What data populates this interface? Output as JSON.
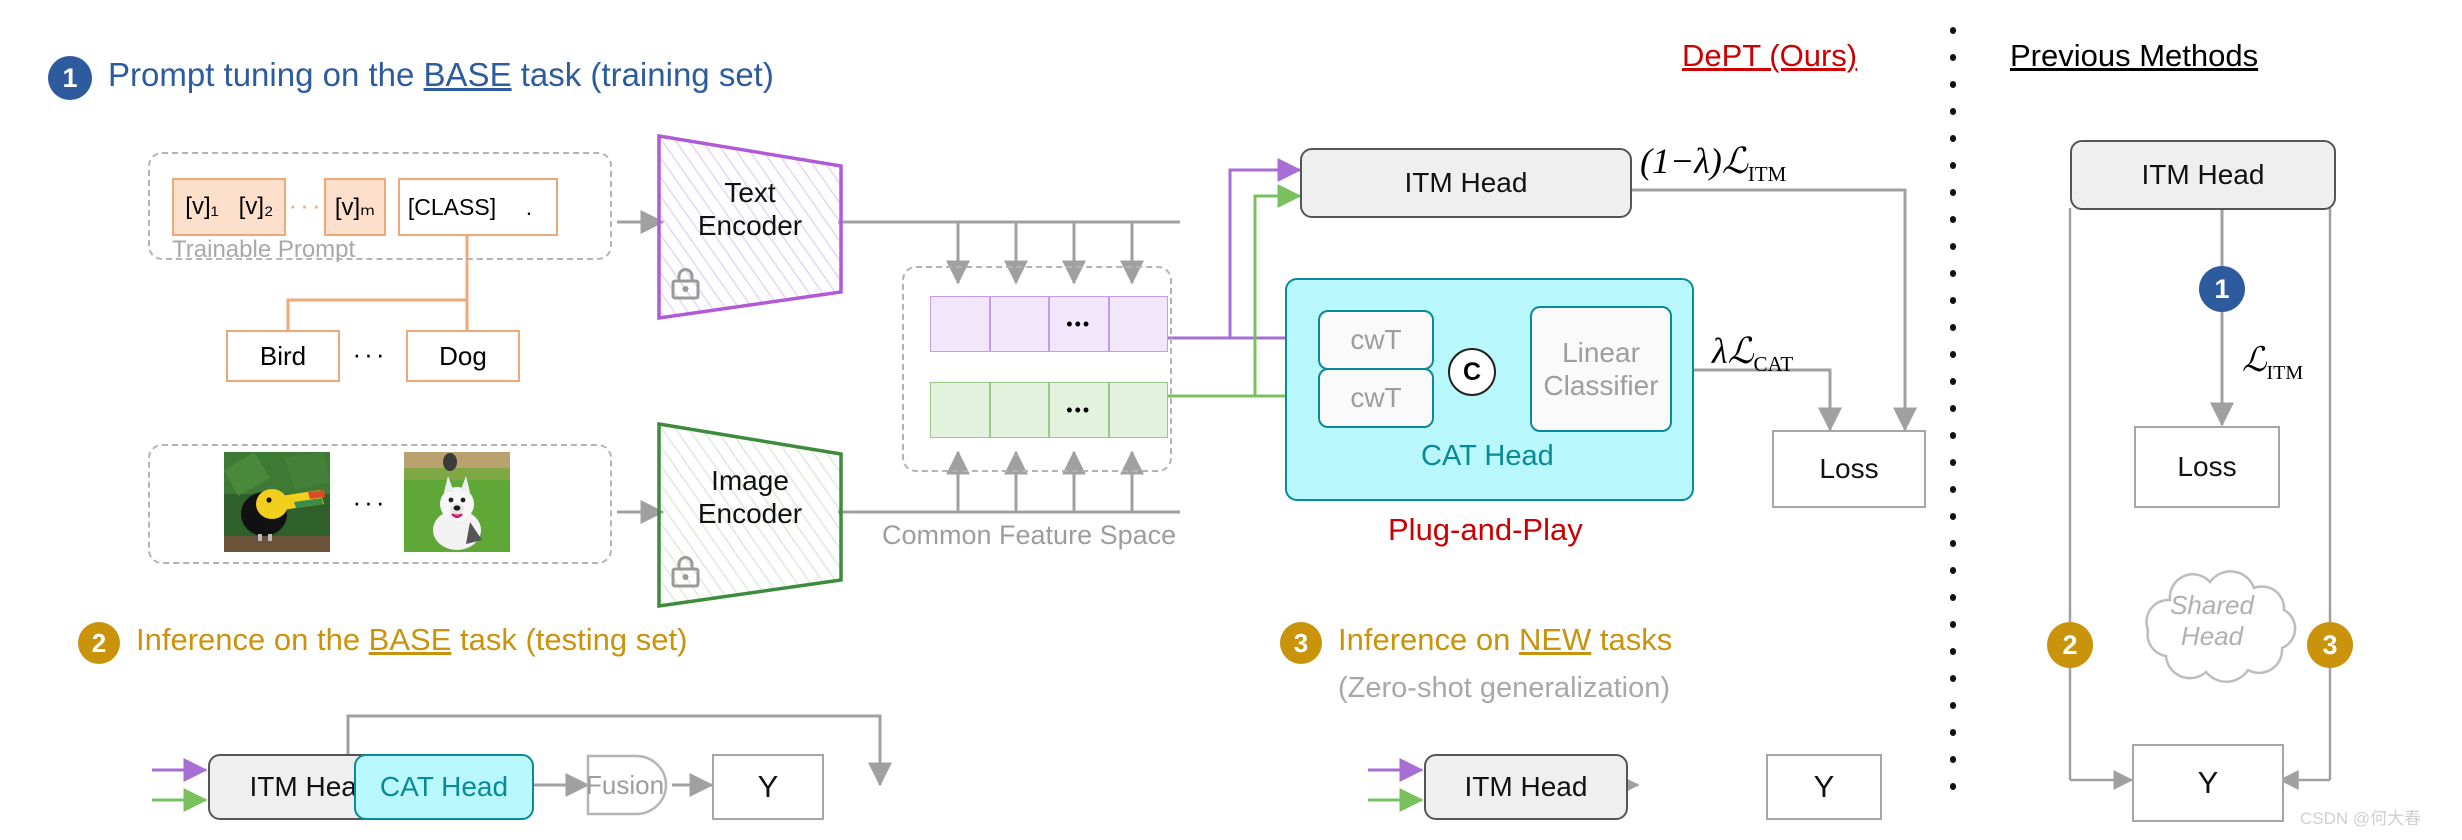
{
  "figure": {
    "title_ours": "DePT (Ours)",
    "title_previous": "Previous Methods",
    "watermark": "CSDN @何大春"
  },
  "steps": [
    {
      "num": "1",
      "color": "#2e5b9e",
      "text_pre": "Prompt tuning on the ",
      "text_underline": "BASE",
      "text_post": " task (training set)"
    },
    {
      "num": "2",
      "color": "#c9940c",
      "text_pre": "Inference on the ",
      "text_underline": "BASE",
      "text_post": " task (testing set)"
    },
    {
      "num": "3",
      "color": "#c9940c",
      "text_pre": "Inference on ",
      "text_underline": "NEW",
      "text_post": " tasks",
      "subtitle": "(Zero-shot generalization)"
    }
  ],
  "prompt": {
    "tokens": [
      "[v]₁",
      "[v]₂",
      "[v]ₘ"
    ],
    "token_labels": [
      "[v]1",
      "[v]2",
      "[v]M"
    ],
    "ellipsis": "···",
    "class_token": "[CLASS]",
    "period": ".",
    "caption": "Trainable Prompt"
  },
  "classes": {
    "first": "Bird",
    "ellipsis": "···",
    "last": "Dog"
  },
  "images": {
    "first_alt": "toucan-photo",
    "ellipsis": "···",
    "last_alt": "husky-photo"
  },
  "encoders": {
    "text": {
      "line1": "Text",
      "line2": "Encoder",
      "color": "#b05ad6",
      "icon": "lock-icon"
    },
    "image": {
      "line1": "Image",
      "line2": "Encoder",
      "color": "#3d8b3d",
      "icon": "lock-icon"
    }
  },
  "feature_space": {
    "caption": "Common Feature Space",
    "text_cells": 4,
    "image_cells": 4,
    "cell_ellipsis": "•••"
  },
  "cat_head": {
    "title": "CAT Head",
    "cwt_top": "cwT",
    "cwt_bottom": "cwT",
    "concat_symbol": "C",
    "classifier_line1": "Linear",
    "classifier_line2": "Classifier",
    "tagline": "Plug-and-Play",
    "tagline_color": "#cc0000"
  },
  "main": {
    "itm_head": "ITM Head",
    "loss_box": "Loss",
    "loss_itm_formula": "(1−λ)ℒ₁ₜₘ",
    "loss_itm_parts": {
      "prefix": "(1−λ)",
      "script": "ℒ",
      "sub": "ITM"
    },
    "loss_cat_parts": {
      "prefix": "λ",
      "script": "ℒ",
      "sub": "CAT"
    }
  },
  "inference_base": {
    "itm_head": "ITM Head",
    "cat_head": "CAT Head",
    "fusion": "Fusion",
    "output": "Y"
  },
  "inference_new": {
    "itm_head": "ITM Head",
    "output": "Y"
  },
  "previous": {
    "itm_head": "ITM Head",
    "badge1": "1",
    "badge2": "2",
    "badge3": "3",
    "loss_label_script": "ℒ",
    "loss_label_sub": "ITM",
    "loss_box": "Loss",
    "shared_head_line1": "Shared",
    "shared_head_line2": "Head",
    "output": "Y"
  },
  "colors": {
    "purple_arrow": "#a76fd4",
    "green_arrow": "#7bc05f",
    "grey_line": "#a0a0a0",
    "teal": "#0a8a96",
    "blue": "#2e5b9e",
    "gold": "#c9940c",
    "red": "#cc0000"
  }
}
